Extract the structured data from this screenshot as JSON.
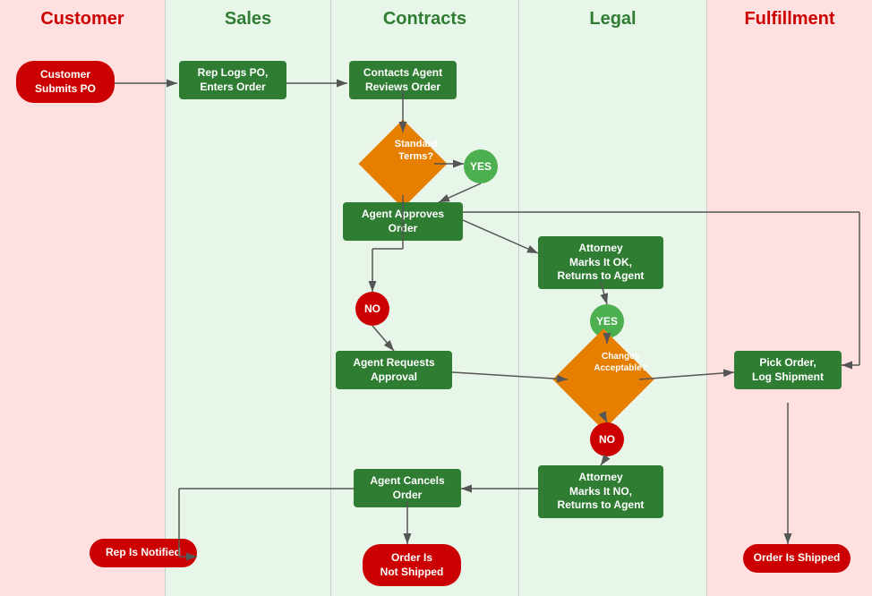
{
  "swimlanes": [
    {
      "id": "customer",
      "label": "Customer",
      "color": "#cc0000",
      "bg": "#ffe0e0"
    },
    {
      "id": "sales",
      "label": "Sales",
      "color": "#2e7d32",
      "bg": "#e8f5e9"
    },
    {
      "id": "contracts",
      "label": "Contracts",
      "color": "#2e7d32",
      "bg": "#e8f5e9"
    },
    {
      "id": "legal",
      "label": "Legal",
      "color": "#2e7d32",
      "bg": "#e8f5e9"
    },
    {
      "id": "fulfillment",
      "label": "Fulfillment",
      "color": "#cc0000",
      "bg": "#ffe0e0"
    }
  ],
  "nodes": {
    "customer_submits_po": "Customer Submits\nPO",
    "rep_logs_po": "Rep Logs PO,\nEnters Order",
    "contacts_agent": "Contacts Agent\nReviews Order",
    "standard_terms": "Standard\nTerms?",
    "yes1": "YES",
    "agent_approves": "Agent Approves\nOrder",
    "attorney_marks_ok": "Attorney\nMarks It OK,\nReturns to Agent",
    "yes2": "YES",
    "changes_acceptable": "Changes\nAcceptable?",
    "no1": "NO",
    "agent_requests": "Agent Requests\nApproval",
    "no2": "NO",
    "attorney_marks_no": "Attorney\nMarks It NO,\nReturns to Agent",
    "agent_cancels": "Agent Cancels\nOrder",
    "pick_order": "Pick Order,\nLog Shipment",
    "rep_notified": "Rep Is Notified",
    "order_not_shipped": "Order Is\nNot Shipped",
    "order_shipped": "Order Is Shipped"
  }
}
